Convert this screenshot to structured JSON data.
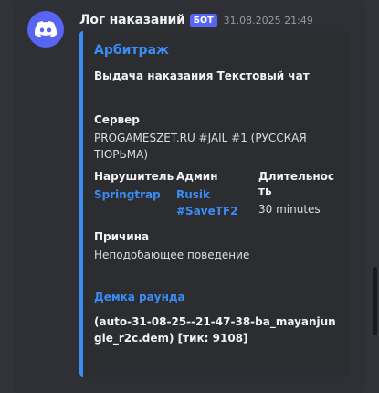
{
  "message": {
    "username": "Лог наказаний",
    "bot_tag": "БОТ",
    "timestamp": "31.08.2025 21:49",
    "avatar_icon": "discord-logo-icon",
    "accent_color": "#5865f2"
  },
  "embed": {
    "accent_color": "#3b8cf5",
    "title": "Арбитраж",
    "description": "Выдача наказания Текстовый чат",
    "server": {
      "label": "Сервер",
      "value": "PROGAMESZET.RU #JAIL #1 (РУССКАЯ ТЮРЬМА)"
    },
    "violator": {
      "label": "Нарушитель",
      "value": "Springtrap"
    },
    "admin": {
      "label": "Админ",
      "value": "Rusik #SaveTF2"
    },
    "duration": {
      "label": "Длительность",
      "value": "30 minutes"
    },
    "reason": {
      "label": "Причина",
      "value": "Неподобающее поведение"
    },
    "demo": {
      "label": "Демка раунда",
      "value": "(auto-31-08-25--21-47-38-ba_mayanjungle_r2c.dem) [тик: 9108]"
    }
  }
}
